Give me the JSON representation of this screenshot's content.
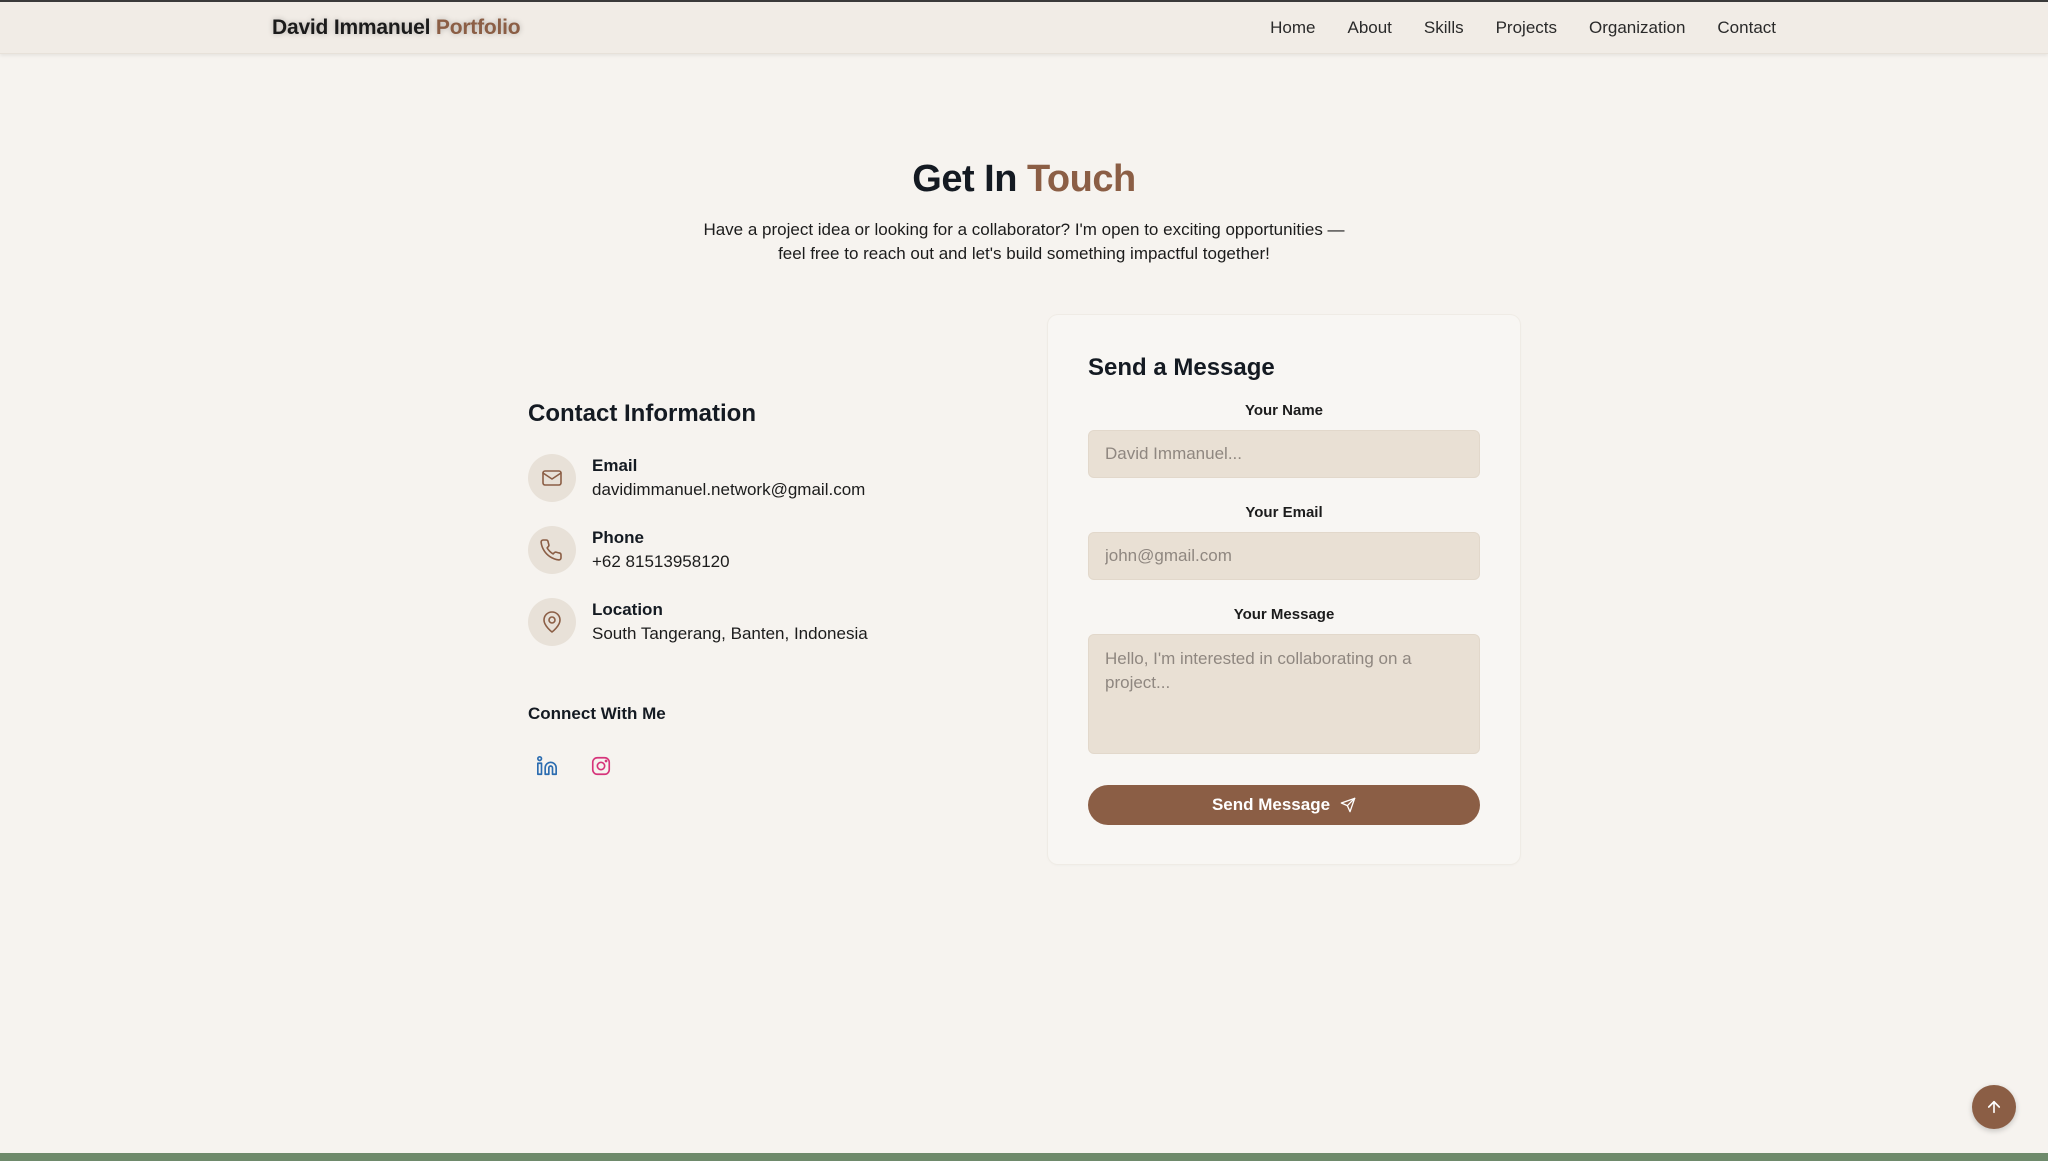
{
  "brand": {
    "name": "David Immanuel",
    "accent": "Portfolio"
  },
  "nav": [
    "Home",
    "About",
    "Skills",
    "Projects",
    "Organization",
    "Contact"
  ],
  "hero": {
    "title_main": "Get In",
    "title_accent": "Touch",
    "subtitle": "Have a project idea or looking for a collaborator? I'm open to exciting opportunities — feel free to reach out and let's build something impactful together!"
  },
  "contact_info": {
    "title": "Contact Information",
    "items": [
      {
        "label": "Email",
        "value": "davidimmanuel.network@gmail.com",
        "icon": "mail-icon"
      },
      {
        "label": "Phone",
        "value": "+62 81513958120",
        "icon": "phone-icon"
      },
      {
        "label": "Location",
        "value": "South Tangerang, Banten, Indonesia",
        "icon": "map-pin-icon"
      }
    ],
    "connect_title": "Connect With Me",
    "socials": [
      "linkedin-icon",
      "instagram-icon"
    ]
  },
  "form": {
    "title": "Send a Message",
    "name_label": "Your Name",
    "name_placeholder": "David Immanuel...",
    "email_label": "Your Email",
    "email_placeholder": "john@gmail.com",
    "message_label": "Your Message",
    "message_placeholder": "Hello, I'm interested in collaborating on a project...",
    "submit_label": "Send Message"
  },
  "colors": {
    "accent": "#8b5e45",
    "background": "#f6f3ef",
    "input_bg": "#e9e0d4",
    "footer_bar": "#6e8a6b",
    "linkedin": "#2b6cb0",
    "instagram": "#d6337a"
  }
}
